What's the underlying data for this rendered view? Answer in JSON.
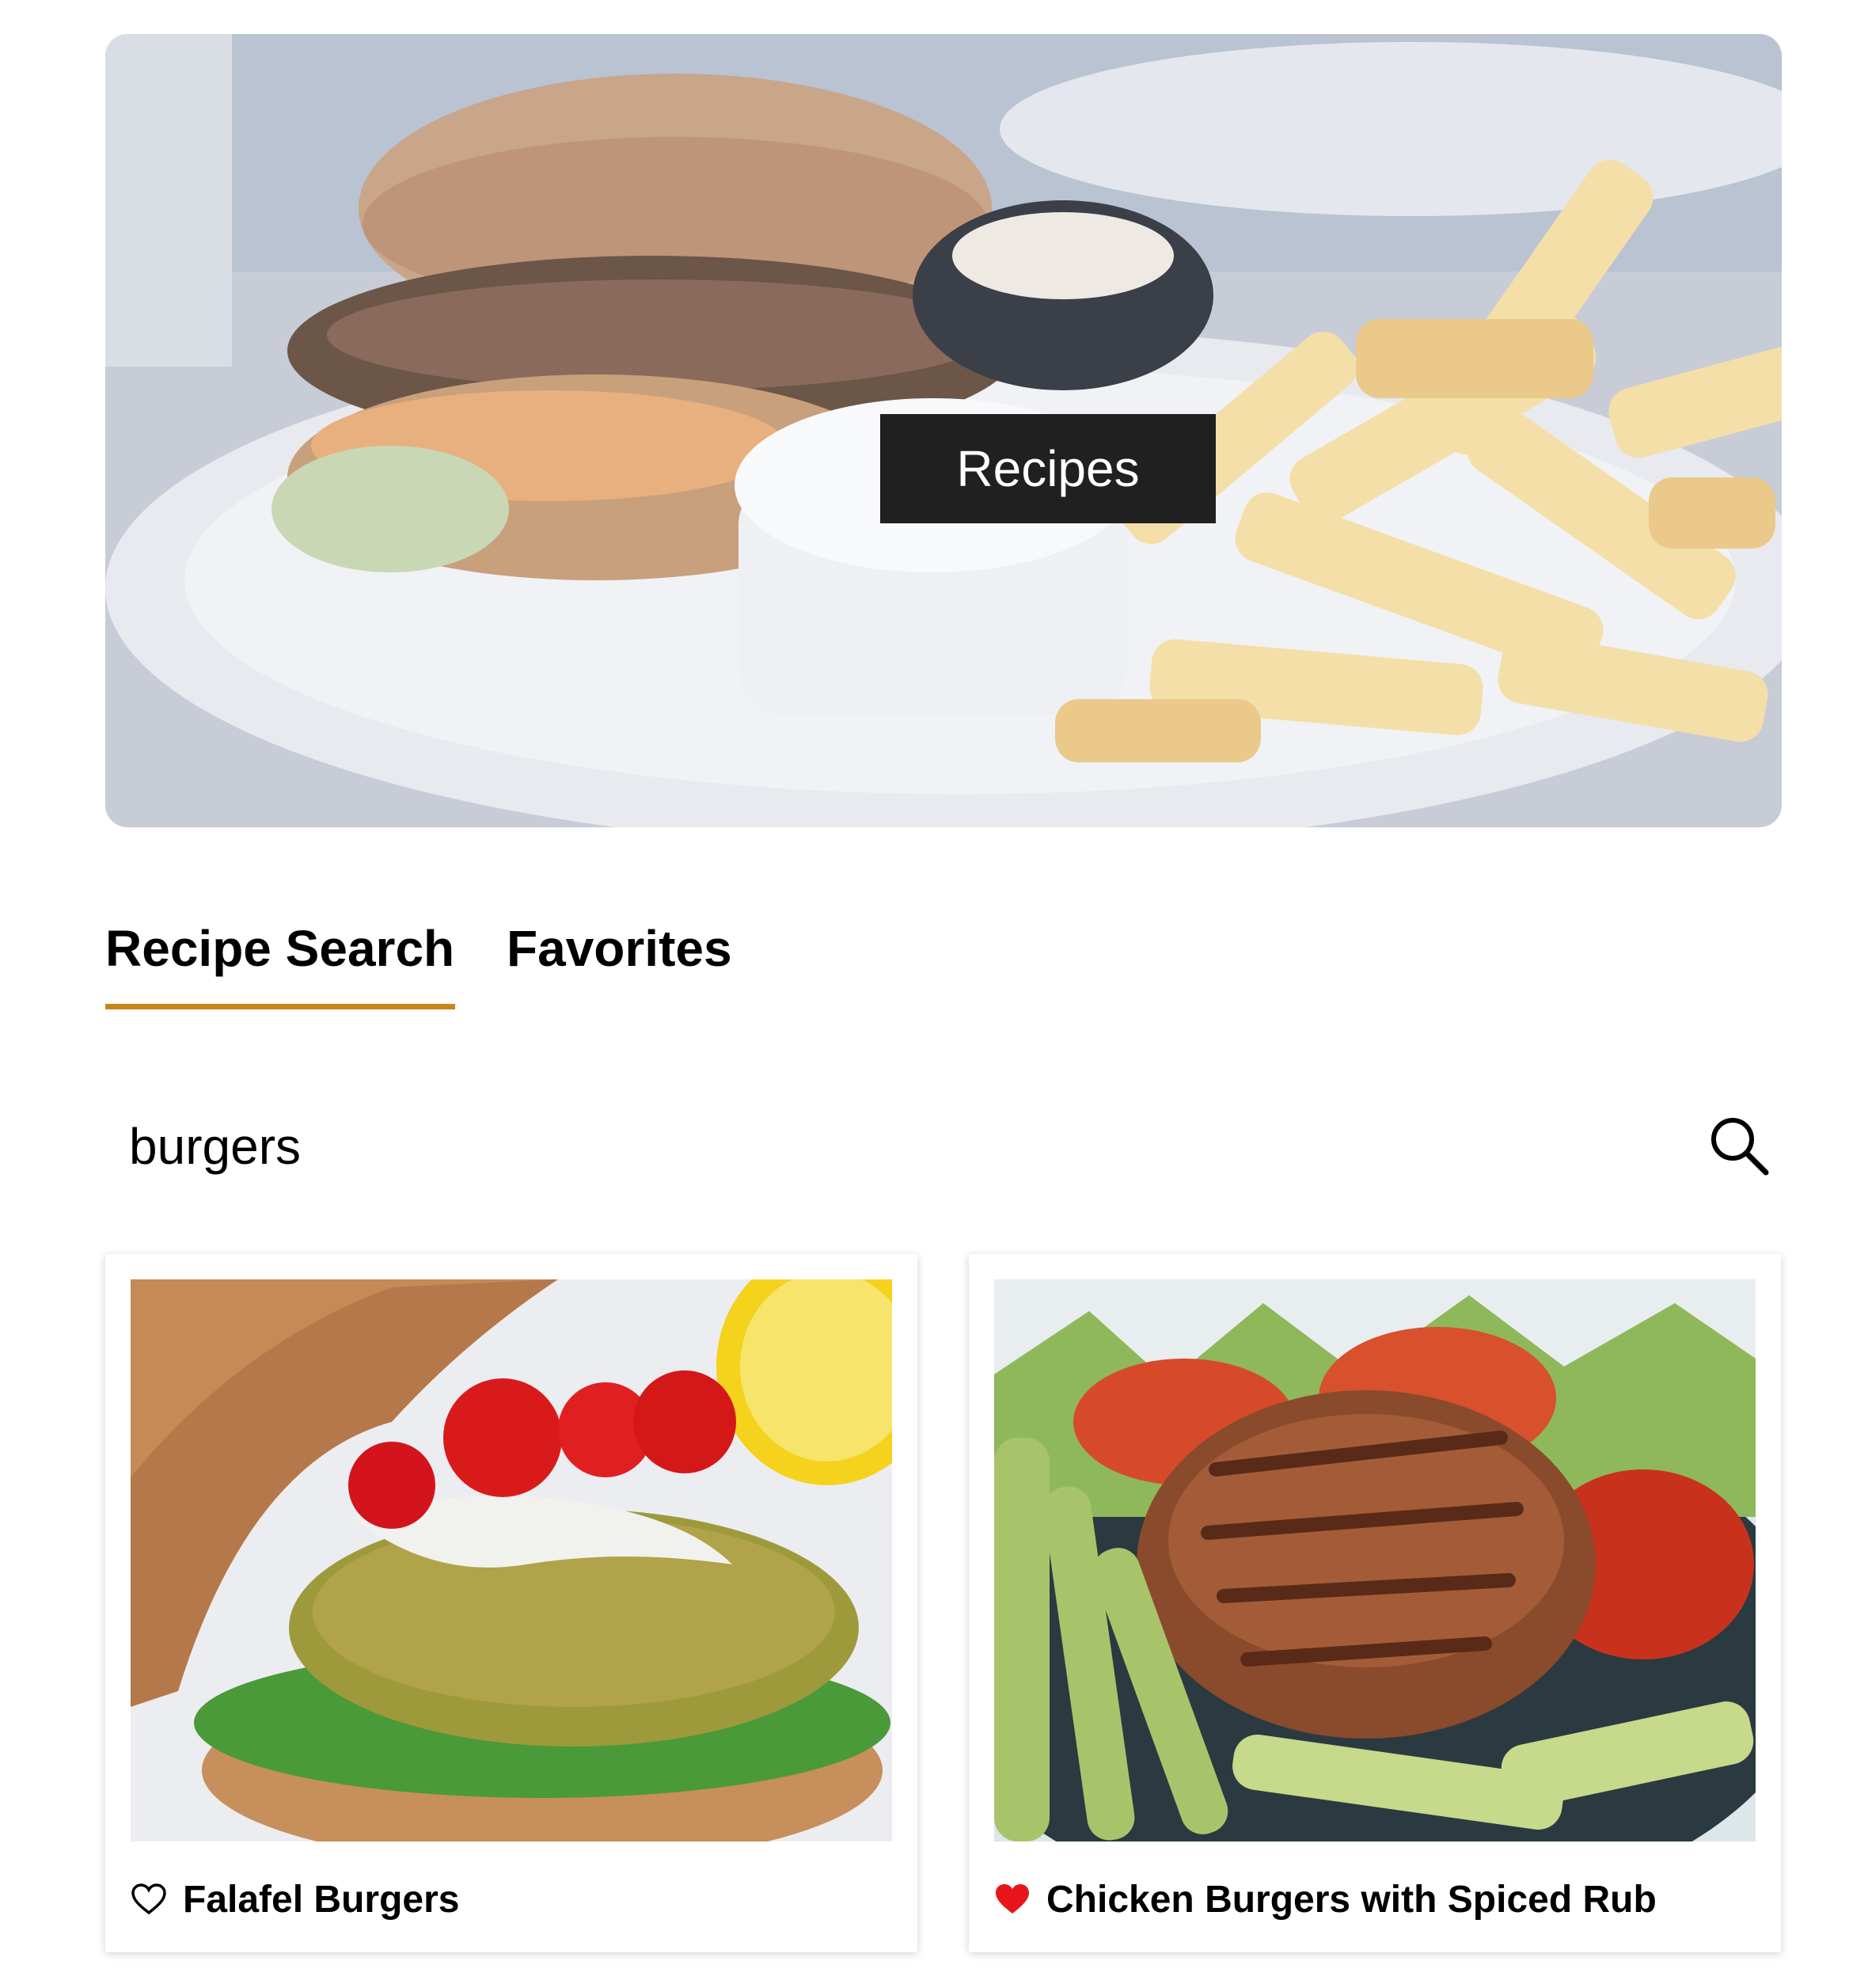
{
  "hero": {
    "title": "Recipes",
    "image": "burger-and-fries-photo"
  },
  "tabs": [
    {
      "label": "Recipe Search",
      "active": true
    },
    {
      "label": "Favorites",
      "active": false
    }
  ],
  "search": {
    "value": "burgers",
    "icon": "search-icon"
  },
  "results": [
    {
      "title": "Falafel Burgers",
      "favorite": false,
      "icon": "heart-outline-icon",
      "image": "falafel-burger-photo"
    },
    {
      "title": "Chicken Burgers with Spiced Rub",
      "favorite": true,
      "icon": "heart-filled-icon",
      "image": "chicken-burger-photo"
    }
  ],
  "colors": {
    "accent": "#c8851a",
    "favorite": "#e8161c",
    "hero_label_bg": "#202020"
  }
}
